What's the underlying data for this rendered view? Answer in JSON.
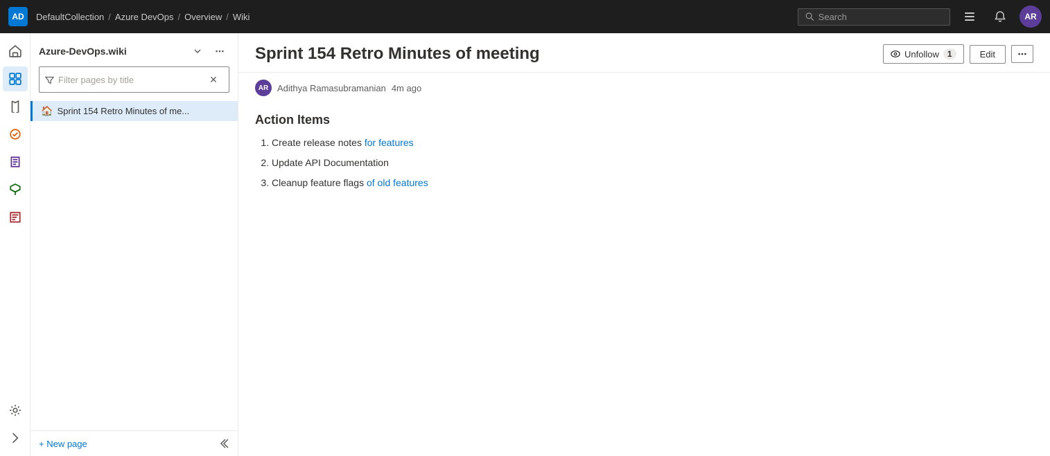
{
  "topNav": {
    "logo": "AD",
    "breadcrumbs": [
      {
        "label": "DefaultCollection",
        "href": "#"
      },
      {
        "label": "Azure DevOps",
        "href": "#"
      },
      {
        "label": "Overview",
        "href": "#"
      },
      {
        "label": "Wiki",
        "href": "#"
      }
    ],
    "search": {
      "placeholder": "Search",
      "value": ""
    },
    "avatarInitials": "AR",
    "avatarBg": "#5c3d99"
  },
  "sidebar": {
    "wikiTitle": "Azure-DevOps.wiki",
    "filterPlaceholder": "Filter pages by title",
    "treeItems": [
      {
        "label": "Sprint 154 Retro Minutes of me...",
        "icon": "🏠",
        "selected": true
      }
    ],
    "newPageLabel": "+ New page",
    "collapseIcon": "«"
  },
  "content": {
    "pageTitle": "Sprint 154 Retro Minutes of meeting",
    "authorAvatar": "AR",
    "authorAvatarBg": "#5c3d99",
    "authorName": "Adithya Ramasubramanian",
    "timeAgo": "4m ago",
    "unfollowLabel": "Unfollow",
    "followersCount": "1",
    "editLabel": "Edit",
    "moreIcon": "...",
    "sectionHeading": "Action Items",
    "actionItems": [
      {
        "text": "Create release notes ",
        "link": "for features",
        "suffix": ""
      },
      {
        "text": "Update API Documentation",
        "link": "",
        "suffix": ""
      },
      {
        "text": "Cleanup feature flags ",
        "link": "of old features",
        "suffix": ""
      }
    ]
  }
}
